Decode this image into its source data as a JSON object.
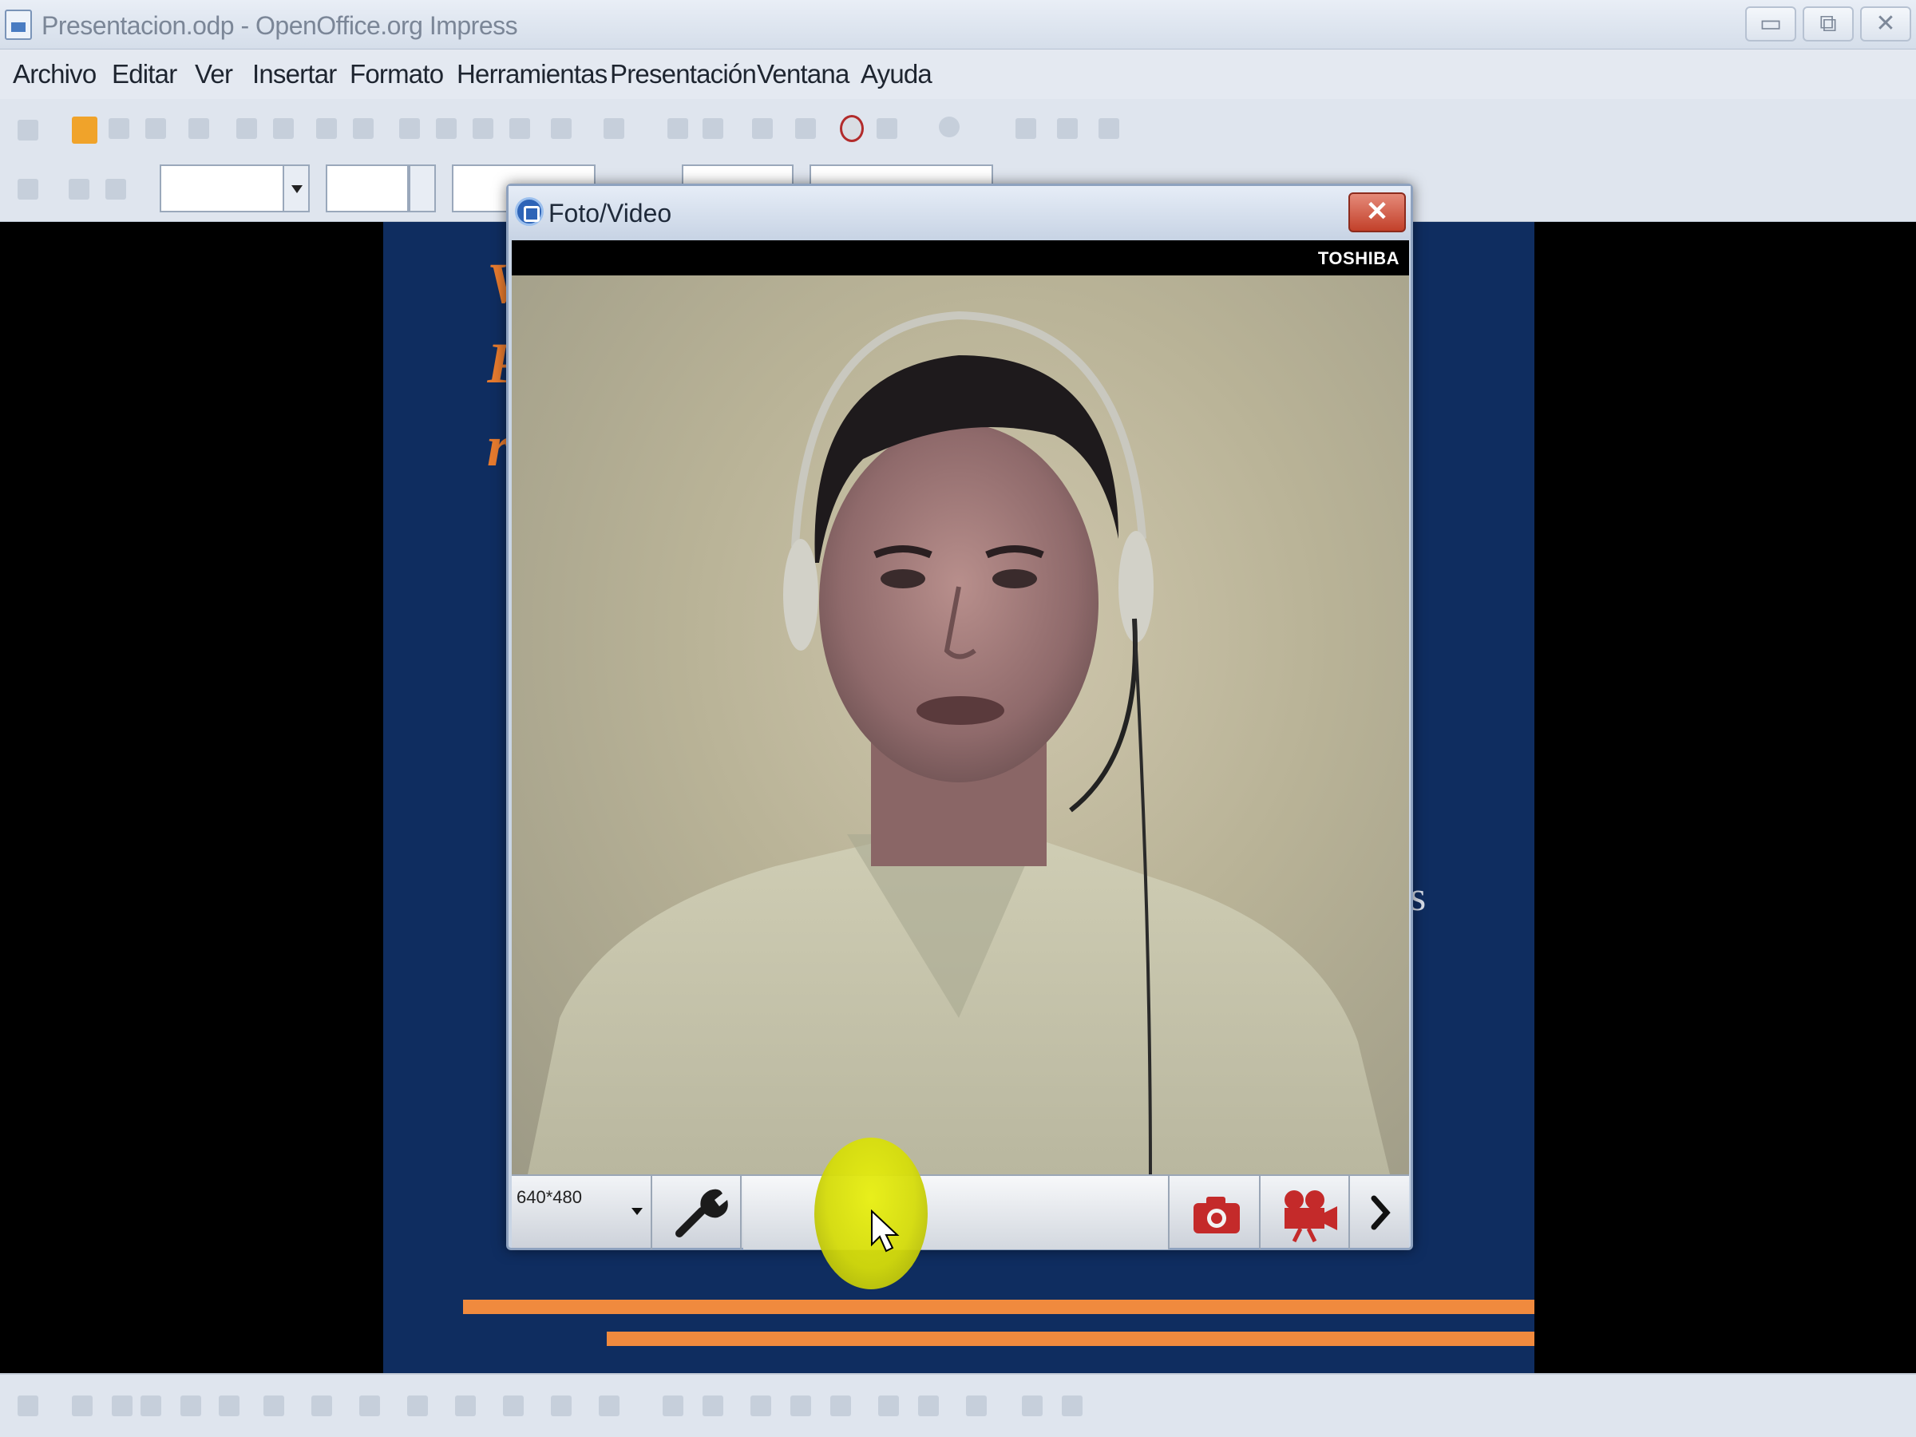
{
  "window": {
    "title": "Presentacion.odp - OpenOffice.org Impress",
    "controls": {
      "minimize": "▭",
      "restore": "⧉",
      "close": "✕"
    }
  },
  "menu": {
    "items": [
      "Archivo",
      "Editar",
      "Ver",
      "Insertar",
      "Formato",
      "Herramientas",
      "Presentación",
      "Ventana",
      "Ayuda"
    ]
  },
  "slide": {
    "visible_fragments": [
      "V",
      "P",
      "r"
    ],
    "right_fragment": "s",
    "accent_color": "#f08a3e",
    "background_color": "#0f2d60"
  },
  "dialog": {
    "title": "Foto/Video",
    "close": "✕",
    "brand": "TOSHIBA",
    "resolution": "640*480",
    "buttons": {
      "settings_icon": "wrench-icon",
      "photo_icon": "camera-icon",
      "video_icon": "video-camera-icon",
      "more_icon": "chevron-right-icon"
    }
  }
}
